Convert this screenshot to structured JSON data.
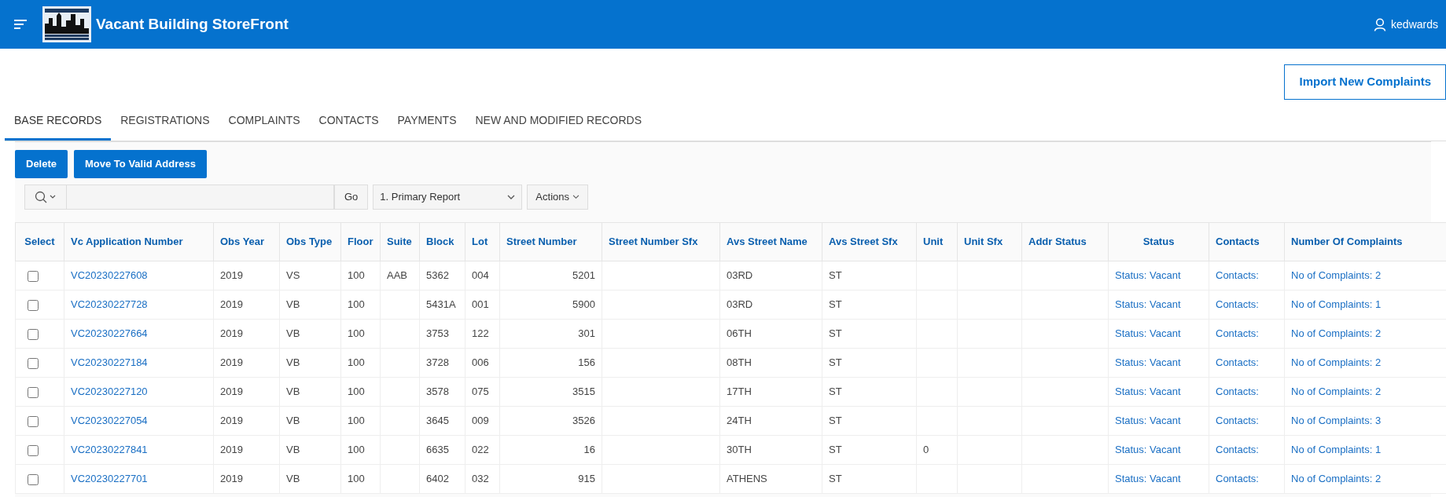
{
  "header": {
    "title": "Vacant Building StoreFront",
    "user": "kedwards"
  },
  "import_button": "Import New Complaints",
  "tabs": [
    {
      "label": "BASE RECORDS",
      "selected": true
    },
    {
      "label": "REGISTRATIONS",
      "selected": false
    },
    {
      "label": "COMPLAINTS",
      "selected": false
    },
    {
      "label": "CONTACTS",
      "selected": false
    },
    {
      "label": "PAYMENTS",
      "selected": false
    },
    {
      "label": "NEW AND MODIFIED RECORDS",
      "selected": false
    }
  ],
  "buttons": [
    "Delete",
    "Move To Valid Address"
  ],
  "toolbar": {
    "go": "Go",
    "report": "1. Primary Report",
    "actions": "Actions"
  },
  "table": {
    "select_column": "Select",
    "columns": [
      "Vc Application Number",
      "Obs Year",
      "Obs Type",
      "Floor",
      "Suite",
      "Block",
      "Lot",
      "Street Number",
      "Street Number Sfx",
      "Avs Street Name",
      "Avs Street Sfx",
      "Unit",
      "Unit Sfx",
      "Addr Status",
      "Status",
      "Contacts",
      "Number Of Complaints"
    ],
    "rows": [
      {
        "checked": false,
        "cells": [
          "VC20230227608",
          "2019",
          "VS",
          "100",
          "AAB",
          "5362",
          "004",
          "5201",
          "",
          "03RD",
          "ST",
          "",
          "",
          "",
          "Status: Vacant",
          "Contacts:",
          "No of Complaints: 2"
        ]
      },
      {
        "checked": false,
        "cells": [
          "VC20230227728",
          "2019",
          "VB",
          "100",
          "",
          "5431A",
          "001",
          "5900",
          "",
          "03RD",
          "ST",
          "",
          "",
          "",
          "Status: Vacant",
          "Contacts:",
          "No of Complaints: 1"
        ]
      },
      {
        "checked": false,
        "cells": [
          "VC20230227664",
          "2019",
          "VB",
          "100",
          "",
          "3753",
          "122",
          "301",
          "",
          "06TH",
          "ST",
          "",
          "",
          "",
          "Status: Vacant",
          "Contacts:",
          "No of Complaints: 2"
        ]
      },
      {
        "checked": false,
        "cells": [
          "VC20230227184",
          "2019",
          "VB",
          "100",
          "",
          "3728",
          "006",
          "156",
          "",
          "08TH",
          "ST",
          "",
          "",
          "",
          "Status: Vacant",
          "Contacts:",
          "No of Complaints: 2"
        ]
      },
      {
        "checked": false,
        "cells": [
          "VC20230227120",
          "2019",
          "VB",
          "100",
          "",
          "3578",
          "075",
          "3515",
          "",
          "17TH",
          "ST",
          "",
          "",
          "",
          "Status: Vacant",
          "Contacts:",
          "No of Complaints: 2"
        ]
      },
      {
        "checked": false,
        "cells": [
          "VC20230227054",
          "2019",
          "VB",
          "100",
          "",
          "3645",
          "009",
          "3526",
          "",
          "24TH",
          "ST",
          "",
          "",
          "",
          "Status: Vacant",
          "Contacts:",
          "No of Complaints: 3"
        ]
      },
      {
        "checked": false,
        "cells": [
          "VC20230227841",
          "2019",
          "VB",
          "100",
          "",
          "6635",
          "022",
          "16",
          "",
          "30TH",
          "ST",
          "0",
          "",
          "",
          "Status: Vacant",
          "Contacts:",
          "No of Complaints: 1"
        ]
      },
      {
        "checked": false,
        "cells": [
          "VC20230227701",
          "2019",
          "VB",
          "100",
          "",
          "6402",
          "032",
          "915",
          "",
          "ATHENS",
          "ST",
          "",
          "",
          "",
          "Status: Vacant",
          "Contacts:",
          "No of Complaints: 2"
        ]
      }
    ]
  }
}
